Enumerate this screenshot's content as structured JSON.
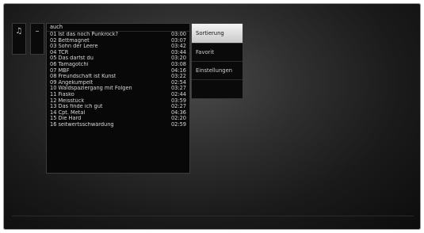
{
  "sidebar": {
    "music_icon": "♫",
    "minus_icon": "–"
  },
  "list": {
    "header": "auch",
    "tracks": [
      {
        "title": "01 Ist das noch Punkrock?",
        "duration": "03:00"
      },
      {
        "title": "02 Bettmagnet",
        "duration": "03:07"
      },
      {
        "title": "03 Sohn der Leere",
        "duration": "03:42"
      },
      {
        "title": "04 TCR",
        "duration": "03:44"
      },
      {
        "title": "05 Das darfst du",
        "duration": "03:20"
      },
      {
        "title": "06 Tamagotchi",
        "duration": "03:08"
      },
      {
        "title": "07 MBF",
        "duration": "04:16"
      },
      {
        "title": "08 Freundschaft ist Kunst",
        "duration": "03:22"
      },
      {
        "title": "09 Angekumpelt",
        "duration": "02:54"
      },
      {
        "title": "10 Waldspaziergang mit Folgen",
        "duration": "03:27"
      },
      {
        "title": "11 Fiasko",
        "duration": "02:44"
      },
      {
        "title": "12 Meisstück",
        "duration": "03:59"
      },
      {
        "title": "13 Das finde ich gut",
        "duration": "02:27"
      },
      {
        "title": "14 Cpt. Metal",
        "duration": "04:36"
      },
      {
        "title": "15 Die Hard",
        "duration": "02:20"
      },
      {
        "title": "16 seitwertsschwärdung",
        "duration": "02:59"
      }
    ]
  },
  "menu": {
    "items": [
      {
        "label": "Sortierung",
        "selected": true
      },
      {
        "label": "Favorit",
        "selected": false
      },
      {
        "label": "Einstellungen",
        "selected": false
      }
    ]
  }
}
